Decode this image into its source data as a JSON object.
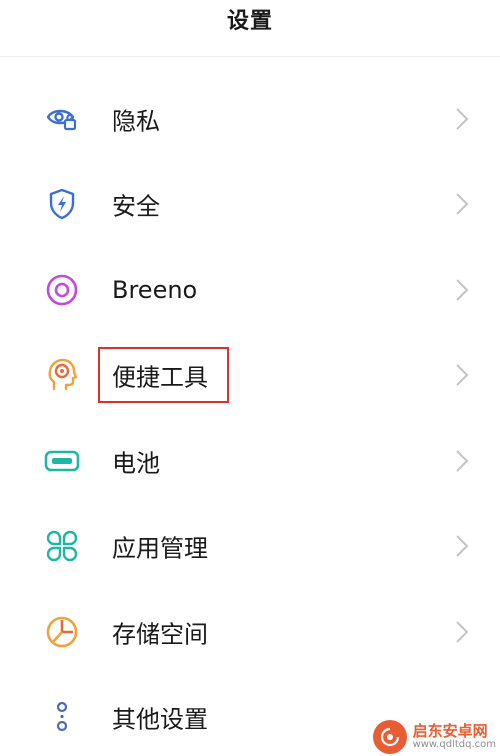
{
  "header": {
    "title": "设置"
  },
  "items": [
    {
      "label": "隐私",
      "icon": "privacy-eye-lock-icon",
      "color": "#3b6fd8"
    },
    {
      "label": "安全",
      "icon": "security-shield-icon",
      "color": "#3b6fd8"
    },
    {
      "label": "Breeno",
      "icon": "breeno-ring-icon",
      "color": "#c24bd8"
    },
    {
      "label": "便捷工具",
      "icon": "convenience-tools-icon",
      "color": "#f0a33a",
      "highlighted": true
    },
    {
      "label": "电池",
      "icon": "battery-icon",
      "color": "#1fb7a3"
    },
    {
      "label": "应用管理",
      "icon": "app-management-icon",
      "color": "#1fb7a3"
    },
    {
      "label": "存储空间",
      "icon": "storage-pie-icon",
      "color": "#f0a33a"
    },
    {
      "label": "其他设置",
      "icon": "other-settings-icon",
      "color": "#4a6bb5"
    }
  ],
  "watermark": {
    "main": "启东安卓网",
    "sub": "www.qdltdq.com"
  },
  "colors": {
    "highlight": "#d9332b",
    "chevron": "#c4c4c4",
    "text": "#1a1a1a"
  }
}
